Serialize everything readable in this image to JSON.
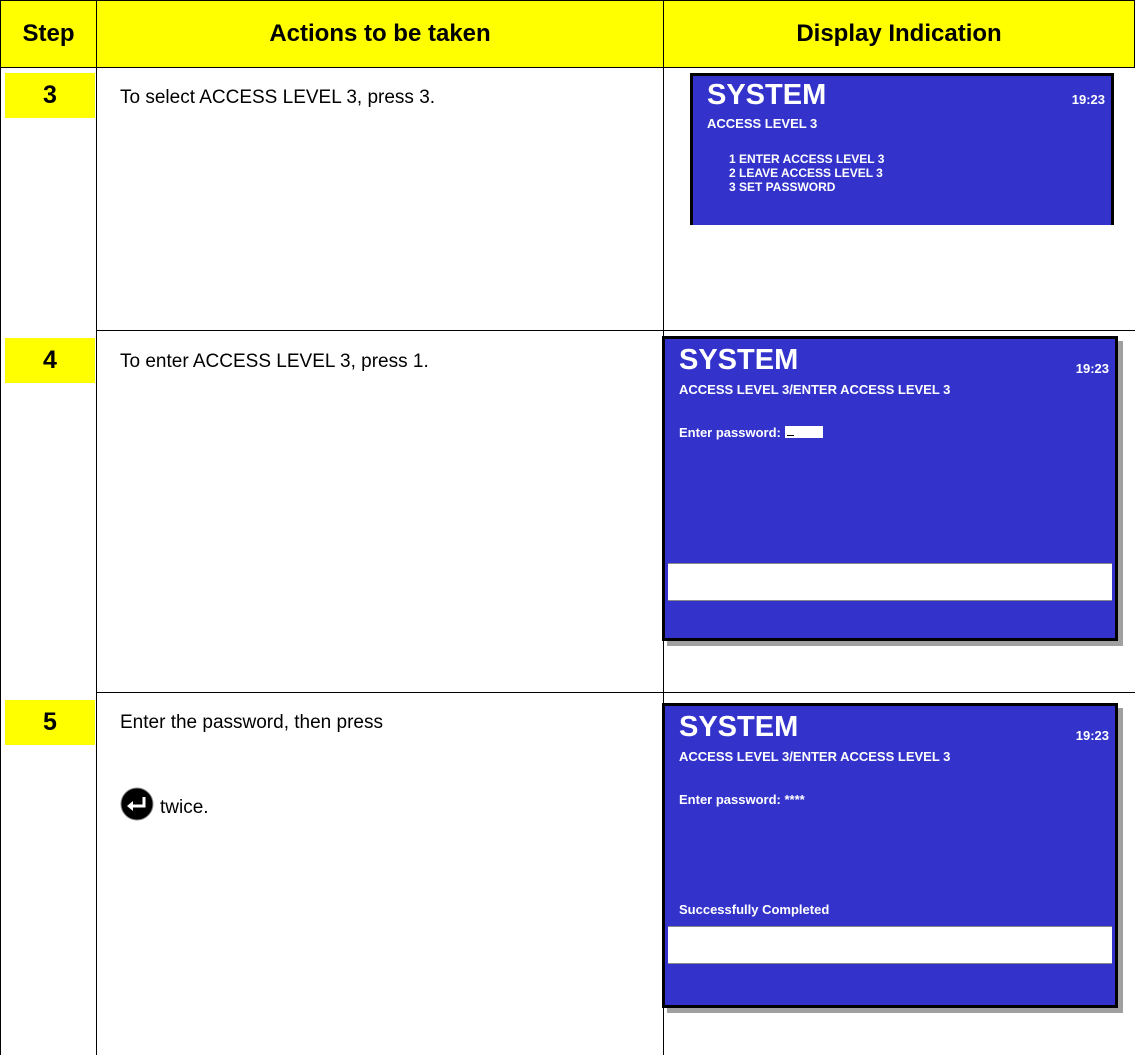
{
  "header": {
    "step": "Step",
    "actions": "Actions to be taken",
    "display": "Display Indication"
  },
  "rows": [
    {
      "step": "3",
      "action": "To select ACCESS LEVEL 3, press 3.",
      "screen": {
        "title": "SYSTEM",
        "time": "19:23",
        "subtitle": "ACCESS LEVEL 3",
        "menu": [
          "1 ENTER ACCESS LEVEL 3",
          "2 LEAVE ACCESS LEVEL 3",
          "3 SET PASSWORD"
        ]
      }
    },
    {
      "step": "4",
      "action": "To enter ACCESS LEVEL 3, press 1.",
      "screen": {
        "title": "SYSTEM",
        "time": "19:23",
        "subtitle": "ACCESS LEVEL 3/ENTER ACCESS LEVEL 3",
        "password_label": "Enter password:"
      }
    },
    {
      "step": "5",
      "action_line1": "Enter the password, then press",
      "action_line2": "twice.",
      "action_icon": "enter-key-icon",
      "screen": {
        "title": "SYSTEM",
        "time": "19:23",
        "subtitle": "ACCESS LEVEL 3/ENTER ACCESS LEVEL 3",
        "password_label": "Enter password: ****",
        "status": "Successfully Completed"
      }
    }
  ],
  "colors": {
    "header_bg": "#ffff00",
    "screen_bg": "#3333cc"
  }
}
